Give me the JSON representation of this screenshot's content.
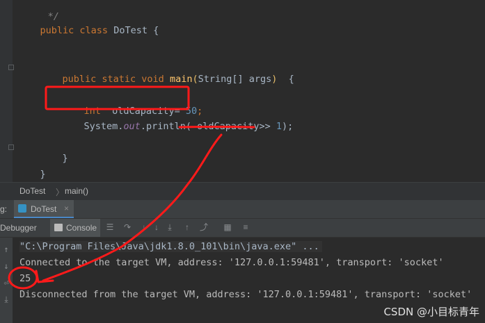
{
  "editor": {
    "lines": {
      "comment_end": " */",
      "class_kw": "public class ",
      "class_name": "DoTest {",
      "main_kw": "public static void ",
      "main_name": "main",
      "main_paren_open": "(",
      "main_params": "String[] args",
      "main_paren_close": ")",
      "main_brace": "  {",
      "int_kw": "int",
      "int_rest": "  oldCapacity= ",
      "int_value": "50",
      "int_semi": ";",
      "sys": "System.",
      "out": "out",
      "println": ".println( oldCapacity>> ",
      "shift_value": "1",
      "println_end": ");",
      "close_inner": "}",
      "close_outer": "}"
    }
  },
  "breadcrumb": {
    "class": "DoTest",
    "sep": "〉",
    "method": "main()"
  },
  "run_panel": {
    "prefix": "g:",
    "tab_label": "DoTest",
    "close": "×"
  },
  "toolbar": {
    "debugger_label": "Debugger",
    "console_label": "Console"
  },
  "console": {
    "lines": [
      "\"C:\\Program Files\\Java\\jdk1.8.0_101\\bin\\java.exe\" ...",
      "Connected to the target VM, address: '127.0.0.1:59481', transport: 'socket'",
      "25",
      "Disconnected from the target VM, address: '127.0.0.1:59481', transport: 'socket'"
    ]
  },
  "watermark": "CSDN @小目标青年",
  "colors": {
    "annotation_red": "#ff1a1a",
    "keyword": "#cc7832",
    "number": "#6897bb"
  }
}
